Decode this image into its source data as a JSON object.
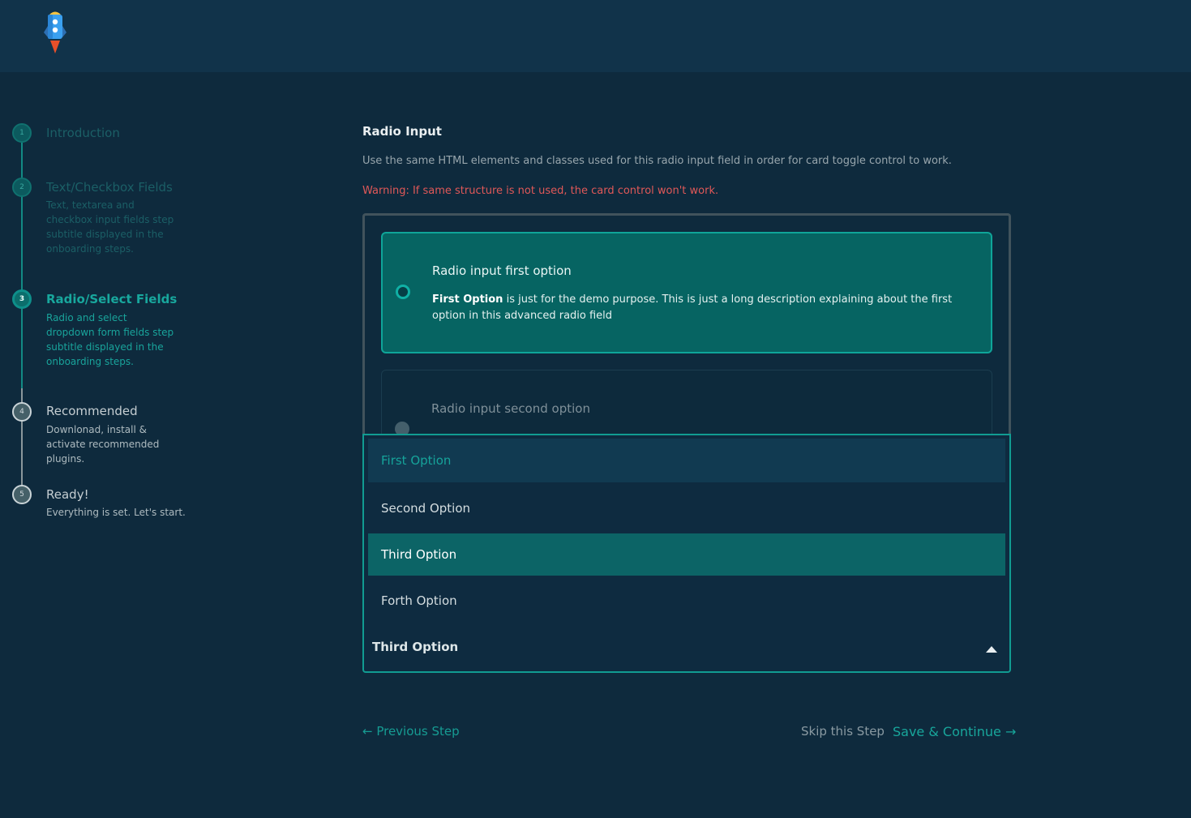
{
  "logo": {
    "icon": "rocket-icon"
  },
  "steps": [
    {
      "number": "1",
      "title": "Introduction",
      "subtitle": ""
    },
    {
      "number": "2",
      "title": "Text/Checkbox Fields",
      "subtitle": "Text, textarea and checkbox input fields step subtitle displayed in the onboarding steps."
    },
    {
      "number": "3",
      "title": "Radio/Select Fields",
      "subtitle": "Radio and select dropdown form fields step subtitle displayed in the onboarding steps."
    },
    {
      "number": "4",
      "title": "Recommended",
      "subtitle": "Downlonad, install & activate recommended plugins."
    },
    {
      "number": "5",
      "title": "Ready!",
      "subtitle": "Everything is set. Let's start."
    }
  ],
  "main": {
    "title": "Radio Input",
    "description": "Use the same HTML elements and classes used for this radio input field in order for card toggle control to work.",
    "warning": "Warning: If same structure is not used, the card control won't work."
  },
  "radio_cards": [
    {
      "title": "Radio input first option",
      "body_bold": "First Option",
      "body_rest": " is just for the demo purpose. This is just a long description explaining about the first option in this advanced radio field",
      "selected": true
    },
    {
      "title": "Radio input second option",
      "selected": false
    }
  ],
  "select": {
    "options": [
      "First Option",
      "Second Option",
      "Third Option",
      "Forth Option"
    ],
    "highlighted": "Third Option",
    "value": "Third Option"
  },
  "footer": {
    "prev_label": "← Previous Step",
    "skip_label": "Skip this Step",
    "save_label": "Save & Continue →"
  },
  "colors": {
    "background": "#0e2a3d",
    "header": "#11334a",
    "accent": "#18a69b",
    "selected_card": "#066462",
    "warning": "#e05858"
  }
}
